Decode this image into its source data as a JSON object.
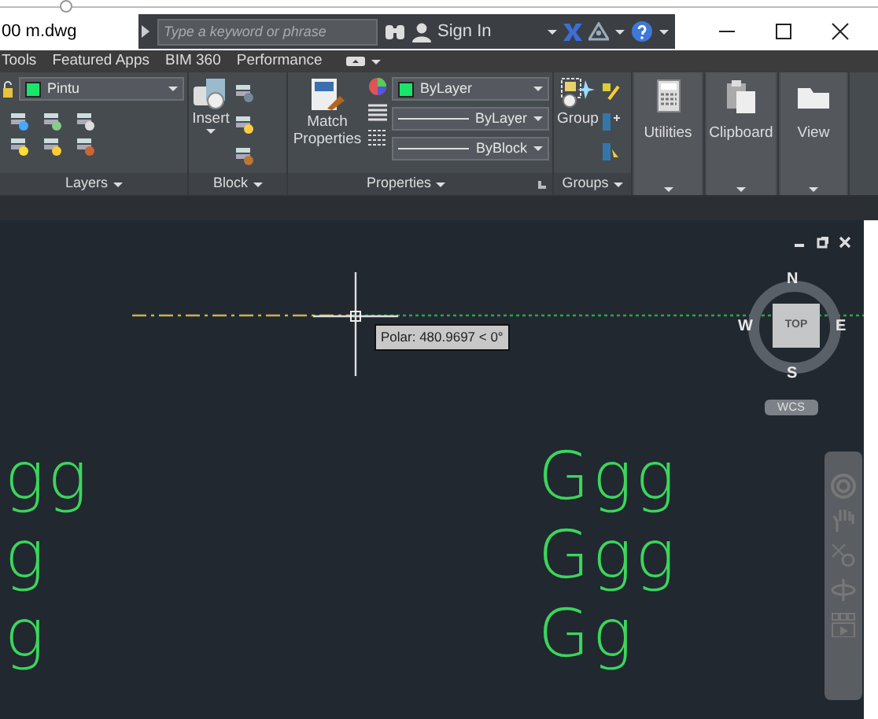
{
  "title_bar": {
    "file_name": "00 m.dwg",
    "search": {
      "placeholder": "Type a keyword or phrase"
    },
    "sign_in": "Sign In"
  },
  "ribbon_tabs": [
    {
      "label": "Tools"
    },
    {
      "label": "Featured Apps"
    },
    {
      "label": "BIM 360"
    },
    {
      "label": "Performance"
    }
  ],
  "panels": {
    "layers": {
      "title": "Layers",
      "layer": {
        "name": "Pintu",
        "color": "#19e56a"
      }
    },
    "block": {
      "title": "Block",
      "insert": "Insert"
    },
    "properties": {
      "title": "Properties",
      "match": "Match Properties",
      "color": {
        "value": "ByLayer",
        "color": "#19e56a"
      },
      "linetype": "ByLayer",
      "lineweight": "ByBlock"
    },
    "groups": {
      "title": "Groups",
      "group": "Group"
    },
    "big_buttons": [
      {
        "label": "Utilities",
        "kind": "calculator"
      },
      {
        "label": "Clipboard",
        "kind": "clipboard"
      },
      {
        "label": "View",
        "kind": "folder"
      }
    ]
  },
  "drawing": {
    "tooltip": "Polar: 480.9697 < 0°",
    "viewcube": {
      "north": "N",
      "south": "S",
      "west": "W",
      "east": "E",
      "face": "TOP",
      "ucs": "WCS"
    },
    "texts_left": [
      "gg",
      "g",
      "g"
    ],
    "texts_right": [
      "Ggg",
      "Ggg",
      "Gg"
    ]
  }
}
